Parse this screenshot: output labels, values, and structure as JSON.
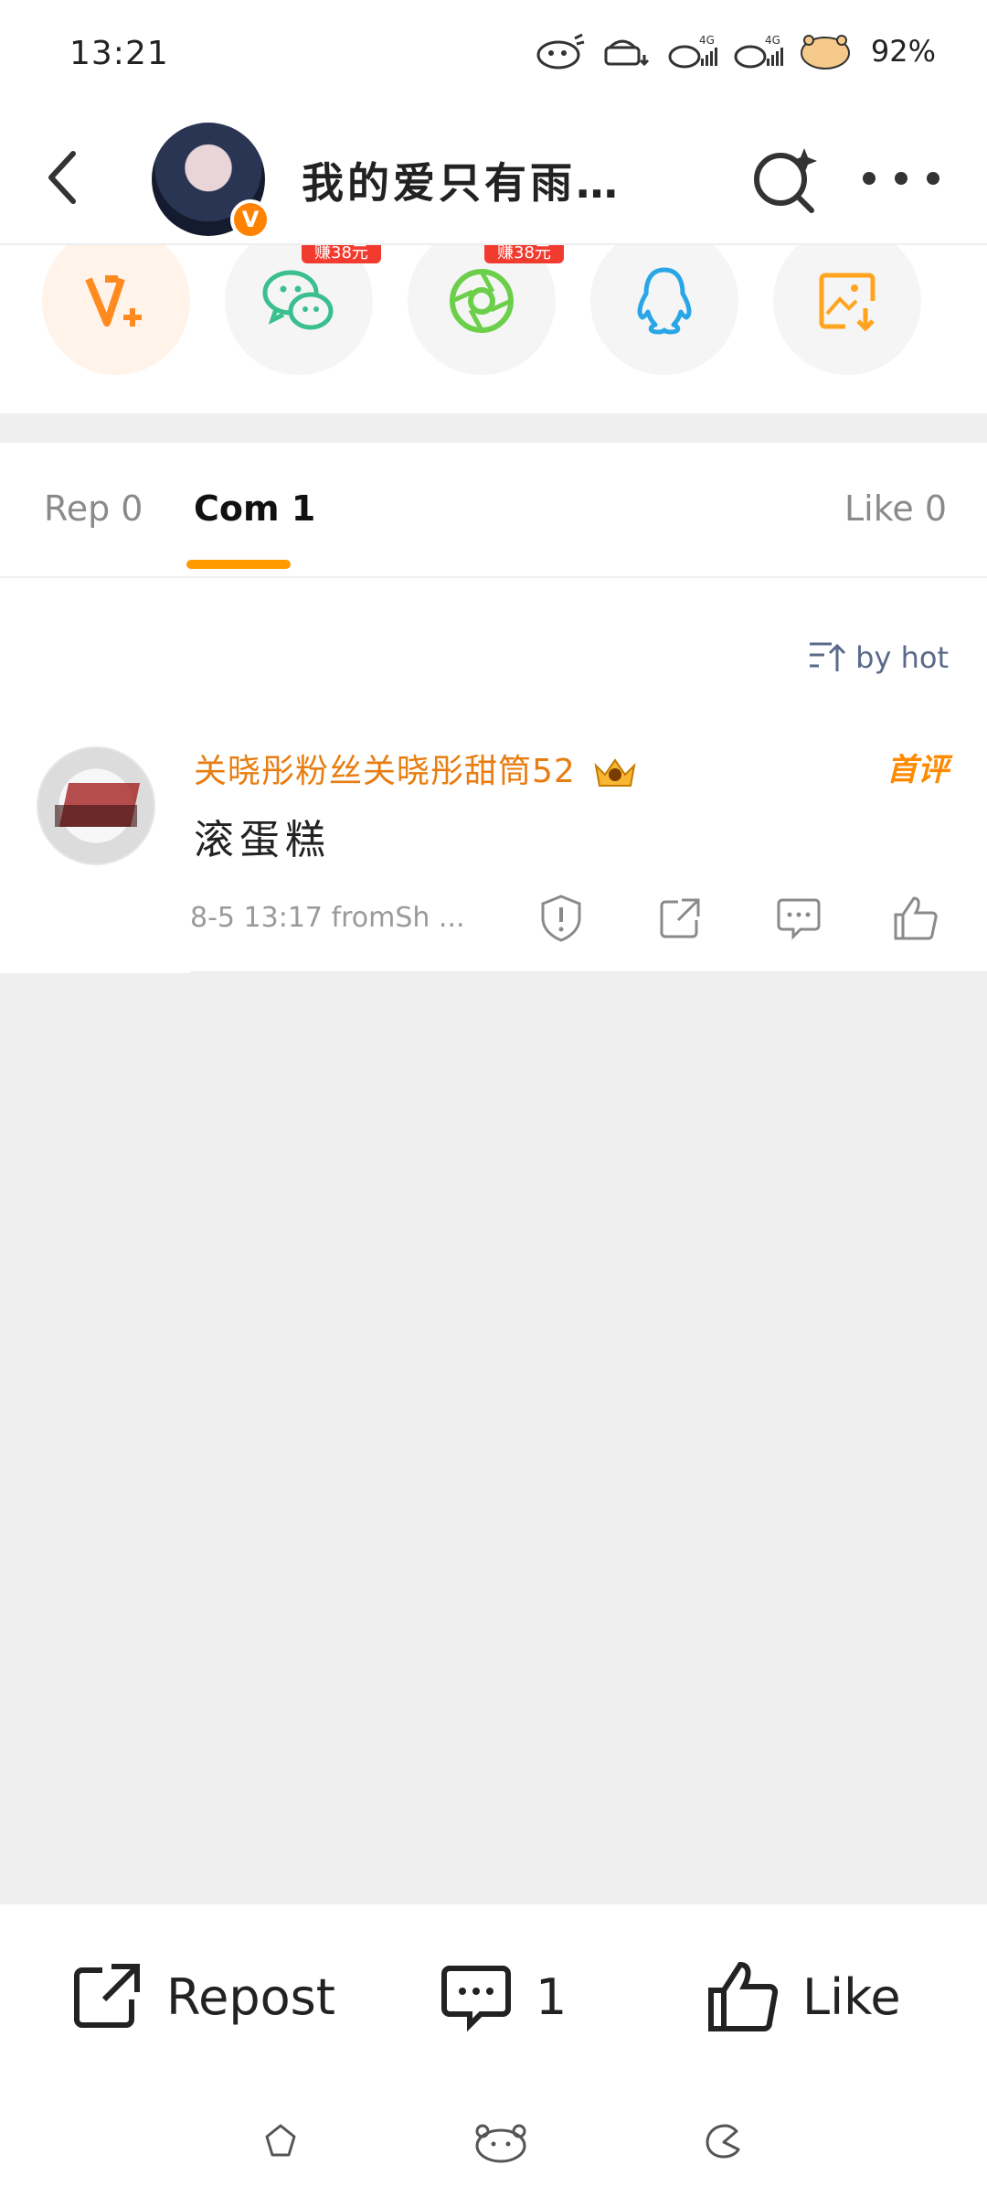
{
  "status": {
    "time": "13:21",
    "battery": "92%",
    "network": "4G"
  },
  "header": {
    "title": "我的爱只有雨滴...",
    "verified_mark": "V"
  },
  "share": {
    "items": [
      {
        "name": "V+",
        "icon": "vplus-icon"
      },
      {
        "name": "WeChat",
        "icon": "wechat-icon",
        "badge": "赚38元"
      },
      {
        "name": "Moments",
        "icon": "moments-icon",
        "badge": "赚38元"
      },
      {
        "name": "QQ",
        "icon": "qq-icon"
      },
      {
        "name": "Save image",
        "icon": "save-image-icon"
      }
    ]
  },
  "tabs": {
    "repost": "Rep 0",
    "comment": "Com 1",
    "like": "Like 0"
  },
  "sort": {
    "label": "by hot"
  },
  "comments": [
    {
      "username": "关晓彤粉丝关晓彤甜筒52",
      "badge": "首评",
      "text": "滚蛋糕",
      "meta": "8-5 13:17  fromSh ..."
    }
  ],
  "bottom_bar": {
    "repost": "Repost",
    "comment_count": "1",
    "like": "Like"
  },
  "colors": {
    "accent": "#ff8200",
    "tab_underline": "#ff9b00",
    "username": "#e87d12",
    "earn_badge": "#f23b2f"
  }
}
